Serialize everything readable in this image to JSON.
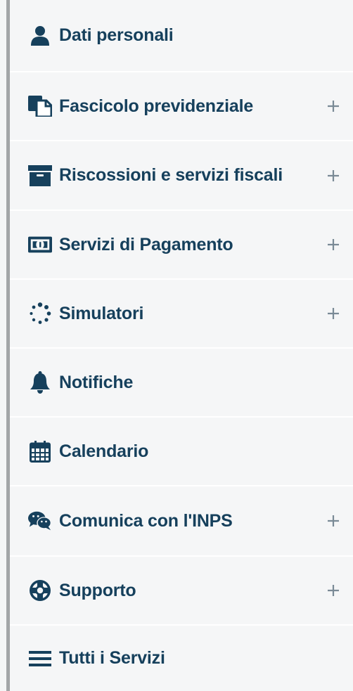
{
  "colors": {
    "panel_bg": "#f5f6f7",
    "accent_bar": "#a3a6a8",
    "label": "#16405c",
    "icon": "#16405c",
    "plus": "#7a8a96"
  },
  "menu": {
    "items": [
      {
        "label": "Dati personali",
        "icon": "user-icon",
        "expandable": false
      },
      {
        "label": "Fascicolo previdenziale",
        "icon": "folder-document-icon",
        "expandable": true
      },
      {
        "label": "Riscossioni e servizi fiscali",
        "icon": "archive-icon",
        "expandable": true
      },
      {
        "label": "Servizi di Pagamento",
        "icon": "money-bill-icon",
        "expandable": true
      },
      {
        "label": "Simulatori",
        "icon": "spinner-icon",
        "expandable": true
      },
      {
        "label": "Notifiche",
        "icon": "bell-icon",
        "expandable": false
      },
      {
        "label": "Calendario",
        "icon": "calendar-icon",
        "expandable": false
      },
      {
        "label": "Comunica con l'INPS",
        "icon": "chat-bubbles-icon",
        "expandable": true
      },
      {
        "label": "Supporto",
        "icon": "life-ring-icon",
        "expandable": true
      },
      {
        "label": "Tutti i Servizi",
        "icon": "menu-bars-icon",
        "expandable": false
      }
    ],
    "expand_symbol": "+"
  }
}
